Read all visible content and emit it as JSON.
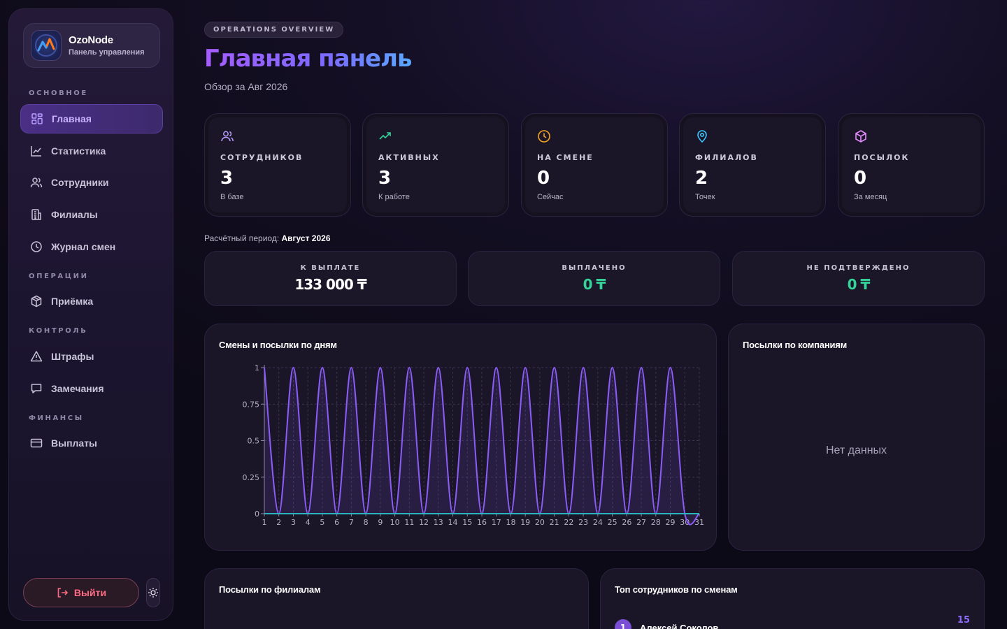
{
  "brand": {
    "name": "OzoNode",
    "subtitle": "Панель управления"
  },
  "sidebar": {
    "sections": {
      "main": "ОСНОВНОЕ",
      "operations": "ОПЕРАЦИИ",
      "control": "КОНТРОЛЬ",
      "finance": "ФИНАНСЫ"
    },
    "items": [
      {
        "label": "Главная",
        "icon": "grid-icon",
        "active": true
      },
      {
        "label": "Статистика",
        "icon": "chart-line-icon"
      },
      {
        "label": "Сотрудники",
        "icon": "users-icon"
      },
      {
        "label": "Филиалы",
        "icon": "building-icon"
      },
      {
        "label": "Журнал смен",
        "icon": "clock-icon"
      },
      {
        "label": "Приёмка",
        "icon": "package-icon"
      },
      {
        "label": "Штрафы",
        "icon": "warning-icon"
      },
      {
        "label": "Замечания",
        "icon": "message-icon"
      },
      {
        "label": "Выплаты",
        "icon": "card-icon"
      }
    ],
    "logout": "Выйти"
  },
  "header": {
    "pill": "OPERATIONS OVERVIEW",
    "title": "Главная панель",
    "subtitle": "Обзор за Авг 2026"
  },
  "stats": [
    {
      "label": "СОТРУДНИКОВ",
      "value": "3",
      "note": "В базе",
      "icon": "users-icon",
      "color": "#b99cff"
    },
    {
      "label": "АКТИВНЫХ",
      "value": "3",
      "note": "К работе",
      "icon": "trending-up-icon",
      "color": "#35d39a"
    },
    {
      "label": "НА СМЕНЕ",
      "value": "0",
      "note": "Сейчас",
      "icon": "clock-icon",
      "color": "#f5a623"
    },
    {
      "label": "ФИЛИАЛОВ",
      "value": "2",
      "note": "Точек",
      "icon": "map-pin-icon",
      "color": "#3cc6ff"
    },
    {
      "label": "ПОСЫЛОК",
      "value": "0",
      "note": "За месяц",
      "icon": "package-icon",
      "color": "#e58bff"
    }
  ],
  "period": {
    "label": "Расчётный период:",
    "value": "Август 2026"
  },
  "payouts": [
    {
      "label": "К ВЫПЛАТЕ",
      "value": "133 000 ₸",
      "color": "#ffffff"
    },
    {
      "label": "ВЫПЛАЧЕНО",
      "value": "0 ₸",
      "color": "#35d39a"
    },
    {
      "label": "НЕ ПОДТВЕРЖДЕНО",
      "value": "0 ₸",
      "color": "#35d39a"
    }
  ],
  "panels": {
    "shifts_chart_title": "Смены и посылки по дням",
    "companies_title": "Посылки по компаниям",
    "companies_empty": "Нет данных",
    "branches_title": "Посылки по филиалам",
    "top_title": "Топ сотрудников по сменам",
    "top": [
      {
        "rank": "1",
        "name": "Алексей Соколов",
        "count": "15"
      }
    ]
  },
  "chart_data": {
    "type": "line",
    "title": "Смены и посылки по дням",
    "x": [
      1,
      2,
      3,
      4,
      5,
      6,
      7,
      8,
      9,
      10,
      11,
      12,
      13,
      14,
      15,
      16,
      17,
      18,
      19,
      20,
      21,
      22,
      23,
      24,
      25,
      26,
      27,
      28,
      29,
      30,
      31
    ],
    "series": [
      {
        "values": [
          1,
          0,
          1,
          0,
          1,
          0,
          1,
          0,
          1,
          0,
          1,
          0,
          1,
          0,
          1,
          0,
          1,
          0,
          1,
          0,
          1,
          0,
          1,
          0,
          1,
          0,
          1,
          0,
          1,
          0,
          0
        ],
        "color": "#8b5cf6"
      },
      {
        "values": [
          0,
          0,
          0,
          0,
          0,
          0,
          0,
          0,
          0,
          0,
          0,
          0,
          0,
          0,
          0,
          0,
          0,
          0,
          0,
          0,
          0,
          0,
          0,
          0,
          0,
          0,
          0,
          0,
          0,
          0,
          0
        ],
        "color": "#2bb3c0"
      }
    ],
    "yticks": [
      "0",
      "0.25",
      "0.5",
      "0.75",
      "1"
    ],
    "ylim": [
      0,
      1
    ],
    "grid": true
  }
}
